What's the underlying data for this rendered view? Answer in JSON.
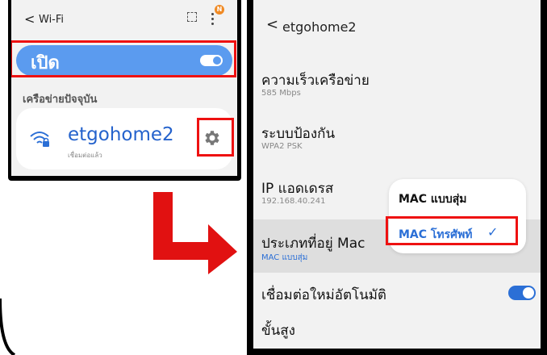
{
  "left_screen": {
    "back_glyph": "<",
    "title": "Wi-Fi",
    "badge": "N",
    "wifi_toggle_label": "เปิด",
    "section_title": "เครือข่ายปัจจุบัน",
    "network": {
      "ssid": "etgohome2",
      "status": "เชื่อมต่อแล้ว"
    },
    "partial_bottom_text": "..."
  },
  "right_screen": {
    "back_glyph": "<",
    "title": "etgohome2",
    "items": [
      {
        "label": "ความเร็วเครือข่าย",
        "value": "585 Mbps"
      },
      {
        "label": "ระบบป้องกัน",
        "value": "WPA2 PSK"
      },
      {
        "label": "IP แอดเดรส",
        "value": "192.168.40.241"
      },
      {
        "label": "ประเภทที่อยู่ Mac",
        "value": "MAC แบบสุ่ม"
      },
      {
        "label": "เชื่อมต่อใหม่อัตโนมัติ",
        "value": ""
      },
      {
        "label": "ขั้นสูง",
        "value": ""
      }
    ],
    "mac_popup": {
      "options": [
        "MAC แบบสุ่ม",
        "MAC โทรศัพท์"
      ],
      "selected_index": 1,
      "check_glyph": "✓"
    }
  },
  "colors": {
    "accent_blue": "#2b6fd6",
    "toggle_blue": "#5b9bef",
    "highlight_red": "#e11111",
    "screen_bg": "#f2f2f2"
  },
  "icons": [
    "back-chevron-icon",
    "qr-scan-icon",
    "more-options-icon",
    "wifi-lock-icon",
    "gear-icon",
    "arrow-icon"
  ]
}
